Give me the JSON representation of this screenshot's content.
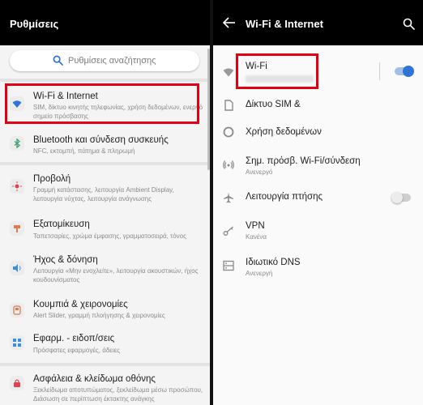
{
  "left": {
    "title": "Ρυθμίσεις",
    "search_placeholder": "Ρυθμίσεις αναζήτησης",
    "items": [
      {
        "title": "Wi-Fi & Internet",
        "subtitle": "SIM, δίκτυο κινητής τηλεφωνίας, χρήση δεδομένων, ενεργό σημείο πρόσβασης",
        "icon": "wifi-icon"
      },
      {
        "title": "Bluetooth και σύνδεση συσκευής",
        "subtitle": "NFC, εκτομπή, πάτημα & πληρωμή",
        "icon": "bluetooth-icon"
      },
      {
        "title": "Προβολή",
        "subtitle": "Γραμμή κατάστασης, λειτουργία Ambient Display, λειτουργία νύχτας, λειτουργία ανάγνωσης",
        "icon": "display-icon"
      },
      {
        "title": "Εξατομίκευση",
        "subtitle": "Ταπετσαρίες, χρώμα έμφασης, γραμματοσειρά, τόνος",
        "icon": "personalization-icon"
      },
      {
        "title": "Ήχος & δόνηση",
        "subtitle": "Λειτουργία «Μην ενοχλείτε», λειτουργία ακουστικών, ήχος κουδουνίσματος",
        "icon": "sound-icon"
      },
      {
        "title": "Κουμπιά & χειρονομίες",
        "subtitle": "Alert Slider, γραμμή πλοήγησης & χειρονομίες",
        "icon": "buttons-icon"
      },
      {
        "title": "Εφαρμ. - ειδοπ/σεις",
        "subtitle": "Πρόσφατες εφαρμογές, άδειες",
        "icon": "apps-icon"
      },
      {
        "title": "Ασφάλεια & κλείδωμα οθόνης",
        "subtitle": "Ξεκλείδωμα αποτυπώματος, ξεκλείδωμα μέσω προσώπου, Διάσωση σε περίπτωση έκτακτης ανάγκης",
        "icon": "security-icon"
      }
    ]
  },
  "right": {
    "title": "Wi-Fi & Internet",
    "items": [
      {
        "title": "Wi-Fi",
        "subtitle": "",
        "icon": "wifi-icon",
        "toggle": "on"
      },
      {
        "title": "Δίκτυο SIM &",
        "subtitle": "",
        "icon": "sim-icon"
      },
      {
        "title": "Χρήση δεδομένων",
        "subtitle": "",
        "icon": "data-usage-icon"
      },
      {
        "title": "Σημ. πρόσβ. Wi-Fi/σύνδεση",
        "subtitle": "Ανενεργό",
        "icon": "hotspot-icon"
      },
      {
        "title": "Λειτουργία πτήσης",
        "subtitle": "",
        "icon": "airplane-icon",
        "toggle": "off"
      },
      {
        "title": "VPN",
        "subtitle": "Κανένα",
        "icon": "vpn-key-icon"
      },
      {
        "title": "Ιδιωτικό DNS",
        "subtitle": "Ανενεργή",
        "icon": "dns-icon"
      }
    ]
  },
  "colors": {
    "accent": "#2f73d4",
    "highlight": "#e00012",
    "appbar": "#000000"
  }
}
